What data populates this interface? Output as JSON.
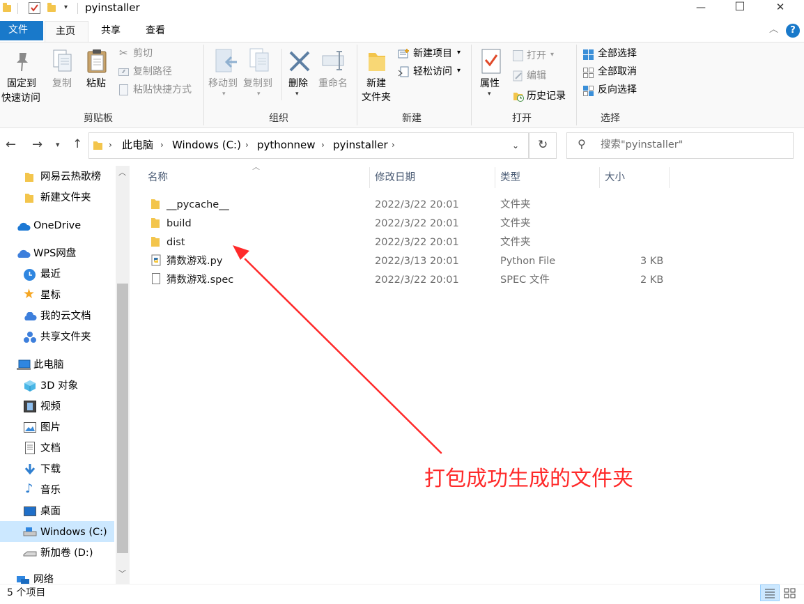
{
  "window": {
    "title": "pyinstaller",
    "minimize": "—",
    "maximize": "☐",
    "close": "✕"
  },
  "ribbon_tabs": [
    "文件",
    "主页",
    "共享",
    "查看"
  ],
  "ribbon": {
    "clipboard": {
      "pin_line1": "固定到",
      "pin_line2": "快速访问",
      "copy": "复制",
      "paste": "粘贴",
      "cut": "剪切",
      "copy_path": "复制路径",
      "paste_shortcut": "粘贴快捷方式",
      "group": "剪贴板"
    },
    "organize": {
      "move_to": "移动到",
      "copy_to": "复制到",
      "delete": "删除",
      "rename": "重命名",
      "group": "组织"
    },
    "new": {
      "new_folder_line1": "新建",
      "new_folder_line2": "文件夹",
      "new_item": "新建项目",
      "easy_access": "轻松访问",
      "group": "新建"
    },
    "open": {
      "properties": "属性",
      "open": "打开",
      "edit": "编辑",
      "history": "历史记录",
      "group": "打开"
    },
    "select": {
      "select_all": "全部选择",
      "select_none": "全部取消",
      "invert": "反向选择",
      "group": "选择"
    }
  },
  "address": {
    "crumbs": [
      "此电脑",
      "Windows (C:)",
      "pythonnew",
      "pyinstaller"
    ],
    "search_placeholder": "搜索\"pyinstaller\""
  },
  "nav": {
    "items": [
      {
        "label": "网易云热歌榜",
        "icon": "folder-icon"
      },
      {
        "label": "新建文件夹",
        "icon": "folder-icon"
      },
      {
        "label": "OneDrive",
        "icon": "cloud-icon"
      },
      {
        "label": "WPS网盘",
        "icon": "cloud-icon"
      },
      {
        "label": "最近",
        "icon": "clock-icon"
      },
      {
        "label": "星标",
        "icon": "star-icon"
      },
      {
        "label": "我的云文档",
        "icon": "cloud-icon"
      },
      {
        "label": "共享文件夹",
        "icon": "share-icon"
      },
      {
        "label": "此电脑",
        "icon": "computer-icon"
      },
      {
        "label": "3D 对象",
        "icon": "cube-icon"
      },
      {
        "label": "视频",
        "icon": "film-icon"
      },
      {
        "label": "图片",
        "icon": "picture-icon"
      },
      {
        "label": "文档",
        "icon": "document-icon"
      },
      {
        "label": "下载",
        "icon": "download-icon"
      },
      {
        "label": "音乐",
        "icon": "music-icon"
      },
      {
        "label": "桌面",
        "icon": "desktop-icon"
      },
      {
        "label": "Windows (C:)",
        "icon": "drive-icon"
      },
      {
        "label": "新加卷 (D:)",
        "icon": "drive-icon"
      },
      {
        "label": "网络",
        "icon": "network-icon"
      }
    ]
  },
  "columns": [
    "名称",
    "修改日期",
    "类型",
    "大小"
  ],
  "files": [
    {
      "name": "__pycache__",
      "date": "2022/3/22 20:01",
      "type": "文件夹",
      "size": "",
      "icon": "folder-icon"
    },
    {
      "name": "build",
      "date": "2022/3/22 20:01",
      "type": "文件夹",
      "size": "",
      "icon": "folder-icon"
    },
    {
      "name": "dist",
      "date": "2022/3/22 20:01",
      "type": "文件夹",
      "size": "",
      "icon": "folder-icon"
    },
    {
      "name": "猜数游戏.py",
      "date": "2022/3/13 20:01",
      "type": "Python File",
      "size": "3 KB",
      "icon": "python-file-icon"
    },
    {
      "name": "猜数游戏.spec",
      "date": "2022/3/22 20:01",
      "type": "SPEC 文件",
      "size": "2 KB",
      "icon": "file-icon"
    }
  ],
  "annotation": {
    "text": "打包成功生成的文件夹",
    "color": "#ff2a2a"
  },
  "status": {
    "item_count": "5 个项目"
  },
  "colors": {
    "accent": "#1979ca",
    "selected": "#cce8ff"
  }
}
